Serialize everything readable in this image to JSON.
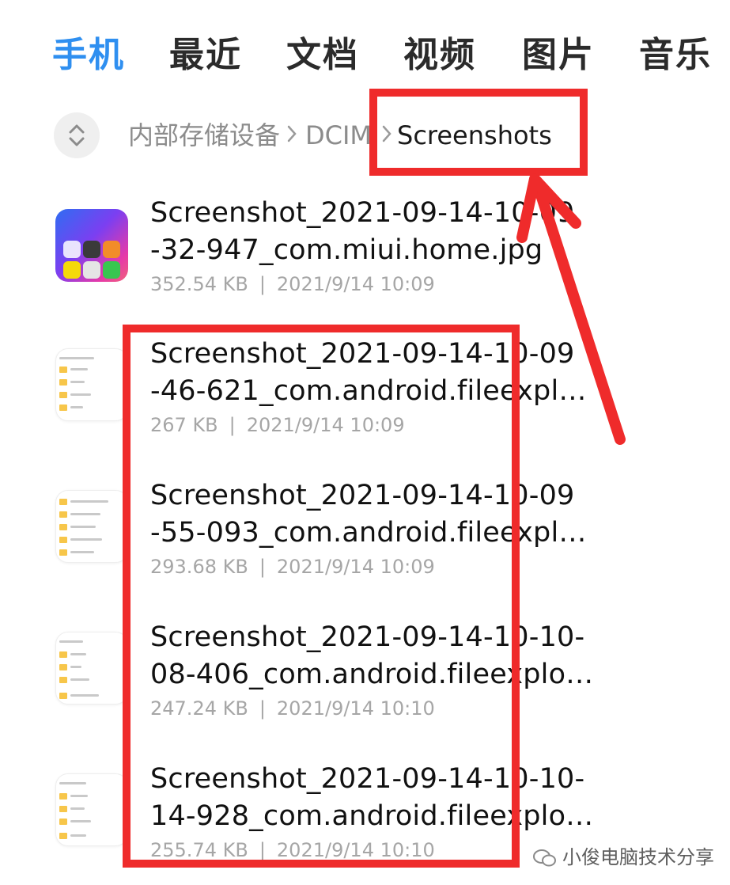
{
  "tabs": [
    {
      "label": "手机",
      "active": true
    },
    {
      "label": "最近",
      "active": false
    },
    {
      "label": "文档",
      "active": false
    },
    {
      "label": "视频",
      "active": false
    },
    {
      "label": "图片",
      "active": false
    },
    {
      "label": "音乐",
      "active": false
    }
  ],
  "breadcrumb": {
    "items": [
      "内部存储设备",
      "DCIM",
      "Screenshots"
    ]
  },
  "files": [
    {
      "name_line1": "Screenshot_2021-09-14-10-09",
      "name_line2": "-32-947_com.miui.home.jpg",
      "size": "352.54 KB",
      "date": "2021/9/14 10:09",
      "thumb": "app"
    },
    {
      "name_line1": "Screenshot_2021-09-14-10-09",
      "name_line2": "-46-621_com.android.fileexpl…",
      "size": "267 KB",
      "date": "2021/9/14 10:09",
      "thumb": "doc"
    },
    {
      "name_line1": "Screenshot_2021-09-14-10-09",
      "name_line2": "-55-093_com.android.fileexpl…",
      "size": "293.68 KB",
      "date": "2021/9/14 10:09",
      "thumb": "doc"
    },
    {
      "name_line1": "Screenshot_2021-09-14-10-10-",
      "name_line2": "08-406_com.android.fileexplo…",
      "size": "247.24 KB",
      "date": "2021/9/14 10:10",
      "thumb": "doc"
    },
    {
      "name_line1": "Screenshot_2021-09-14-10-10-",
      "name_line2": "14-928_com.android.fileexplo…",
      "size": "255.74 KB",
      "date": "2021/9/14 10:10",
      "thumb": "doc"
    }
  ],
  "meta_separator": "|",
  "watermark": "小俊电脑技术分享",
  "colors": {
    "accent": "#2f8ff0",
    "annotation": "#ef2b2b",
    "meta_text": "#a6a6a6"
  }
}
